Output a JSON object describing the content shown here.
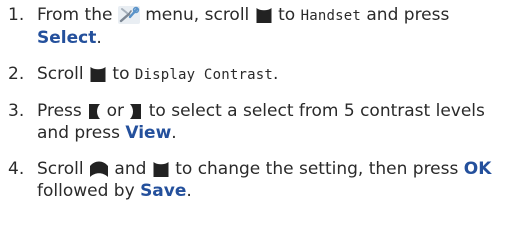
{
  "steps": [
    {
      "number": "1.",
      "text_a": "From the",
      "icon_a": "settings-wrench-icon",
      "text_b": "menu, scroll",
      "icon_b": "scroll-down-key-icon",
      "text_c": "to",
      "lcd_1": "Handset",
      "text_d": "and press",
      "keyword": "Select",
      "text_e": "."
    },
    {
      "number": "2.",
      "text_a": "Scroll",
      "icon_a": "scroll-down-key-icon",
      "text_b": "to",
      "lcd_1": "Display Contrast",
      "text_c": "."
    },
    {
      "number": "3.",
      "text_a": "Press",
      "icon_a": "left-key-icon",
      "text_b": "or",
      "icon_b": "right-key-icon",
      "text_c": "to select a select from 5 contrast levels and press",
      "keyword": "View",
      "text_d": "."
    },
    {
      "number": "4.",
      "text_a": "Scroll",
      "icon_a": "scroll-up-key-icon",
      "text_b": "and",
      "icon_b": "scroll-down-key-icon",
      "text_c": "to change the setting, then press",
      "keyword_1": "OK",
      "text_d": "followed by",
      "keyword_2": "Save",
      "text_e": "."
    }
  ],
  "colors": {
    "keyword": "#24509c",
    "text": "#2a2a2a",
    "icon": "#222222"
  }
}
